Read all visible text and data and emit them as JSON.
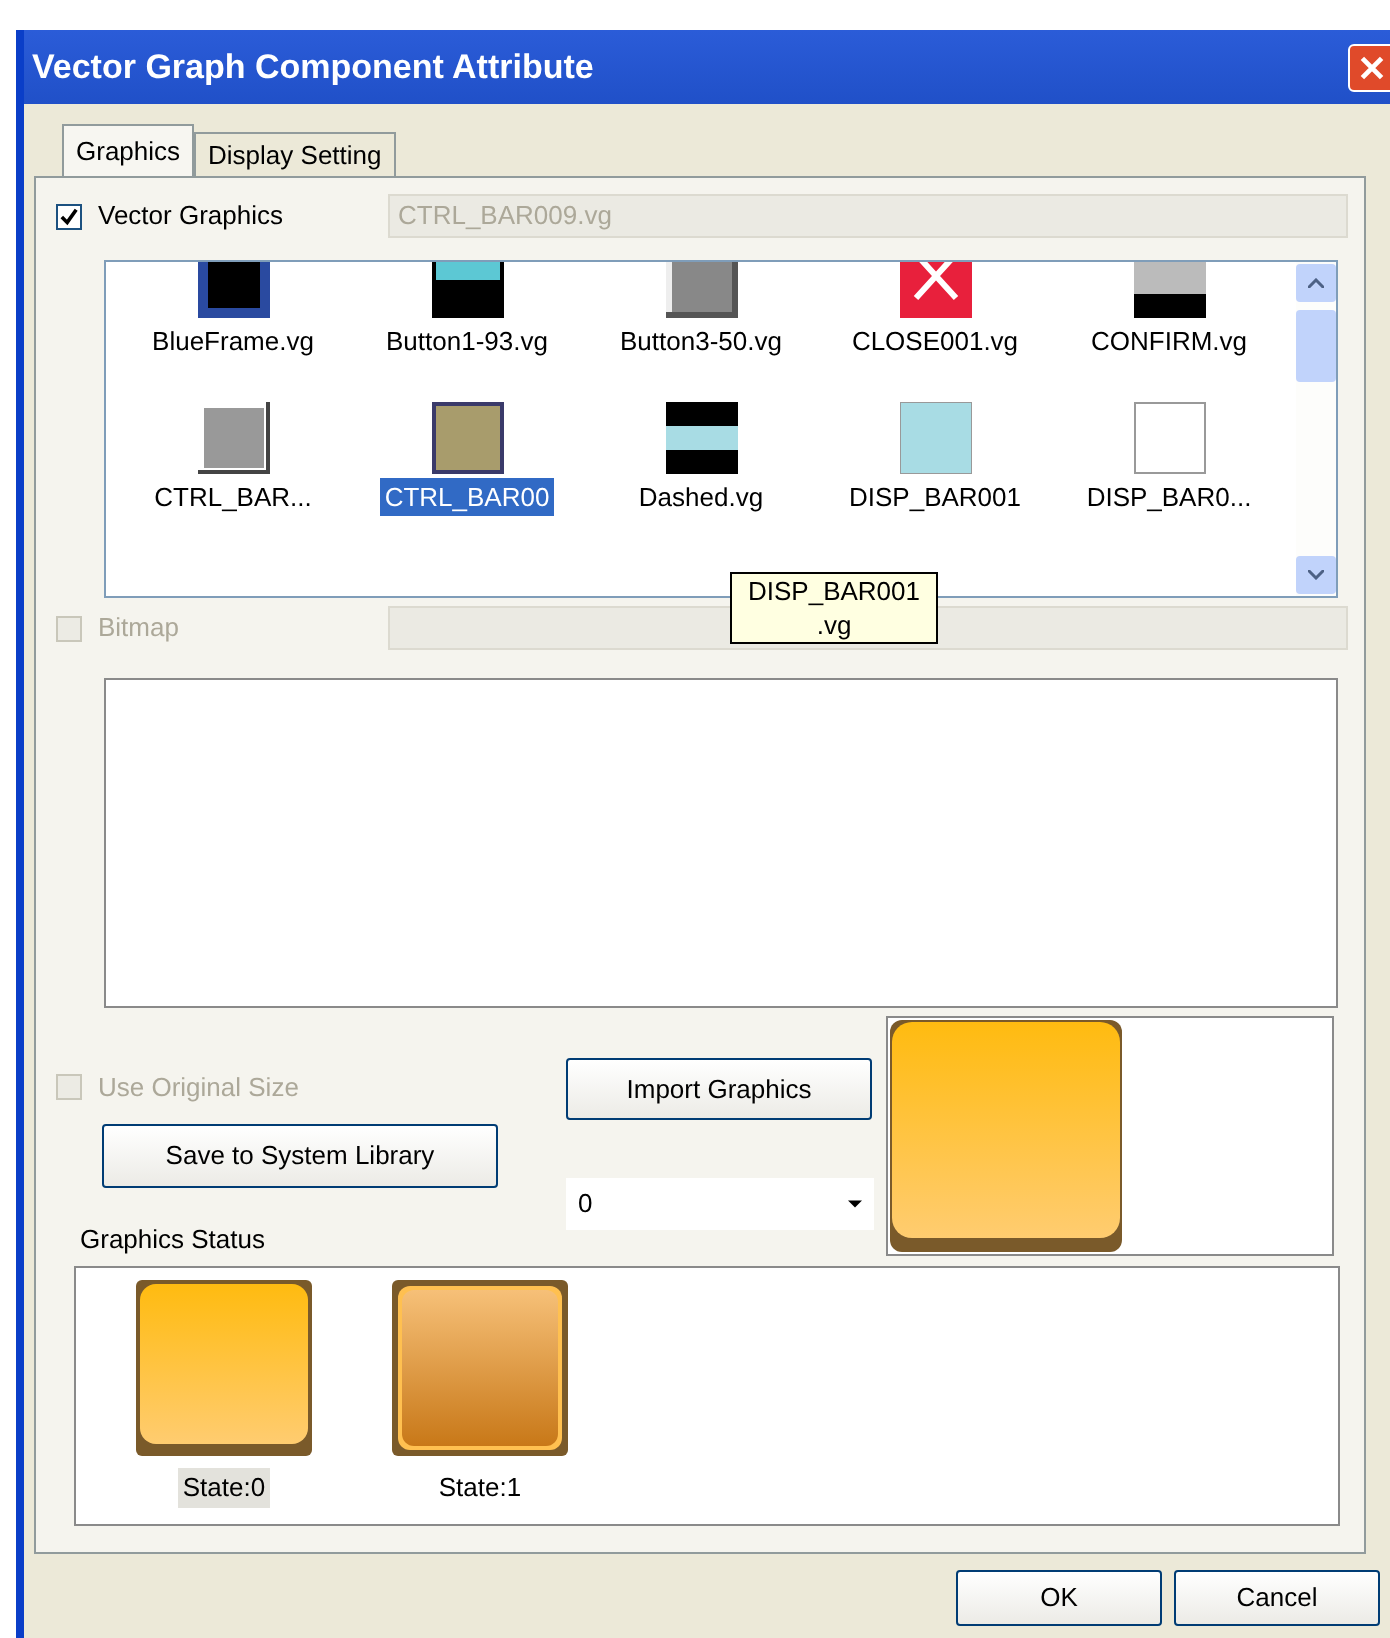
{
  "window": {
    "title": "Vector Graph Component Attribute"
  },
  "tabs": [
    {
      "label": "Graphics",
      "selected": true
    },
    {
      "label": "Display Setting",
      "selected": false
    }
  ],
  "vector_graphics": {
    "label": "Vector Graphics",
    "checked": true,
    "disabled": false,
    "value": "CTRL_BAR009.vg"
  },
  "library": {
    "items": [
      {
        "name": "BlueFrame.vg",
        "kind": "frame",
        "selected": false
      },
      {
        "name": "Button1-93.vg",
        "kind": "screen",
        "selected": false
      },
      {
        "name": "Button3-50.vg",
        "kind": "bevel",
        "selected": false
      },
      {
        "name": "CLOSE001.vg",
        "kind": "close",
        "selected": false
      },
      {
        "name": "CONFIRM.vg",
        "kind": "confirm",
        "selected": false
      },
      {
        "name": "CTRL_BAR...",
        "kind": "raised",
        "selected": false
      },
      {
        "name": "CTRL_BAR00",
        "kind": "pattern",
        "selected": true
      },
      {
        "name": "Dashed.vg",
        "kind": "dashed",
        "selected": false
      },
      {
        "name": "DISP_BAR001",
        "kind": "fill",
        "selected": false
      },
      {
        "name": "DISP_BAR0...",
        "kind": "blank",
        "selected": false
      }
    ],
    "tooltip": [
      "DISP_BAR001",
      ".vg"
    ]
  },
  "bitmap": {
    "label": "Bitmap",
    "checked": false,
    "disabled": true
  },
  "use_original_size": {
    "label": "Use Original Size",
    "checked": false,
    "disabled": true
  },
  "buttons": {
    "save": "Save to System Library",
    "import": "Import Graphics",
    "ok": "OK",
    "cancel": "Cancel"
  },
  "state_select": {
    "value": "0"
  },
  "graphics_status": {
    "label": "Graphics Status",
    "states": [
      {
        "label": "State:0",
        "kind": "normal",
        "selected": true
      },
      {
        "label": "State:1",
        "kind": "pressed",
        "selected": false
      }
    ]
  }
}
